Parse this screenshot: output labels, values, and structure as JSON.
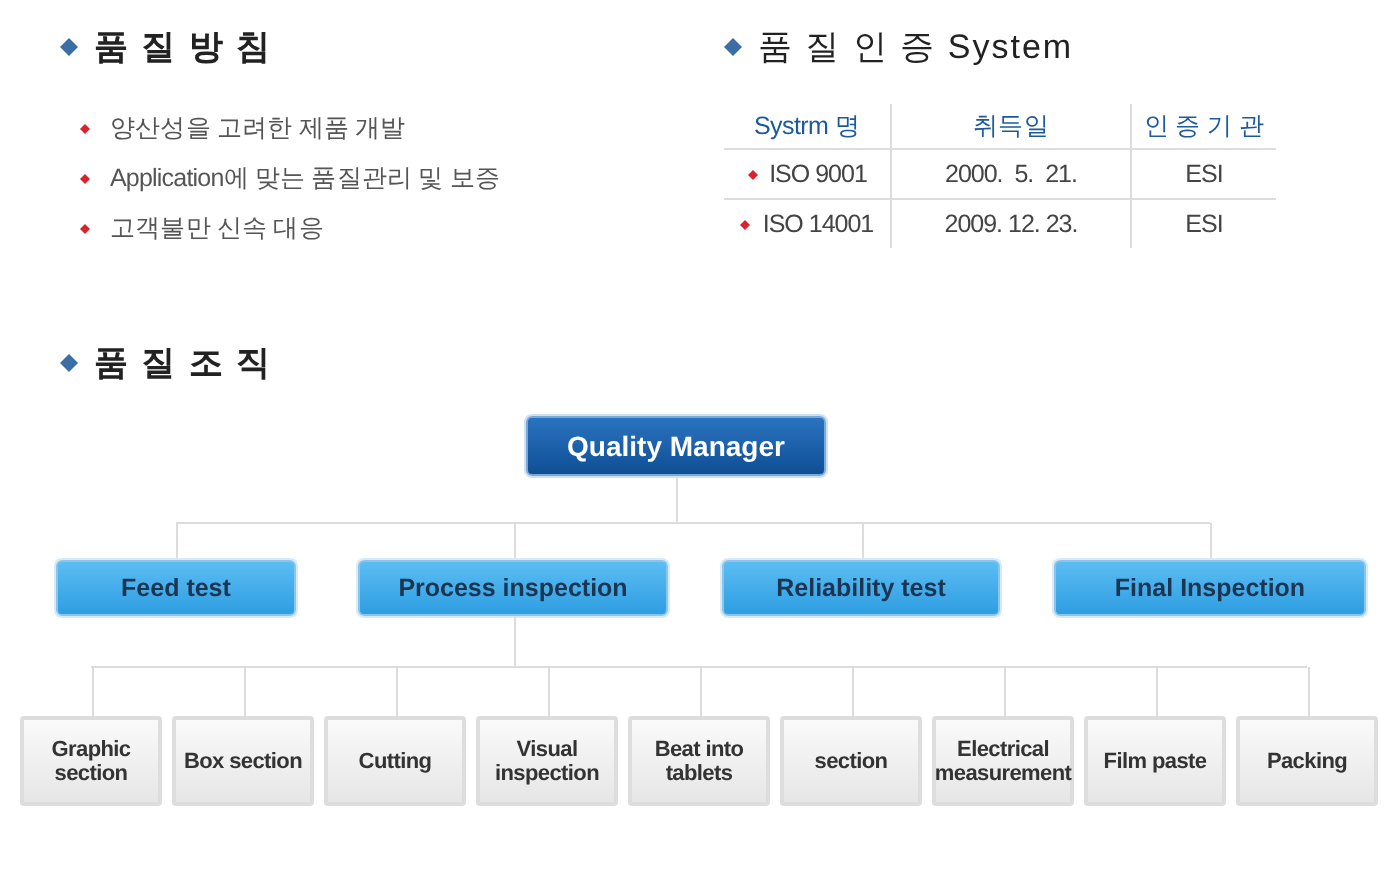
{
  "policy": {
    "title": "품 질 방 침",
    "items": [
      "양산성을 고려한 제품 개발",
      "Application에 맞는 품질관리 및 보증",
      "고객불만 신속 대응"
    ]
  },
  "certification": {
    "title": "품 질 인 증 System",
    "columns": [
      "Systrm 명",
      "취득일",
      "인 증 기 관"
    ],
    "rows": [
      {
        "system": "ISO 9001",
        "date": "2000.  5.  21.",
        "agency": "ESI"
      },
      {
        "system": "ISO 14001",
        "date": "2009. 12. 23.",
        "agency": "ESI"
      }
    ]
  },
  "organization": {
    "title": "품 질 조 직",
    "head": "Quality Manager",
    "departments": [
      "Feed test",
      "Process inspection",
      "Reliability test",
      "Final Inspection"
    ],
    "sections": [
      "Graphic section",
      "Box section",
      "Cutting",
      "Visual inspection",
      "Beat into tablets",
      "section",
      "Electrical measurement",
      "Film paste",
      "Packing"
    ]
  }
}
